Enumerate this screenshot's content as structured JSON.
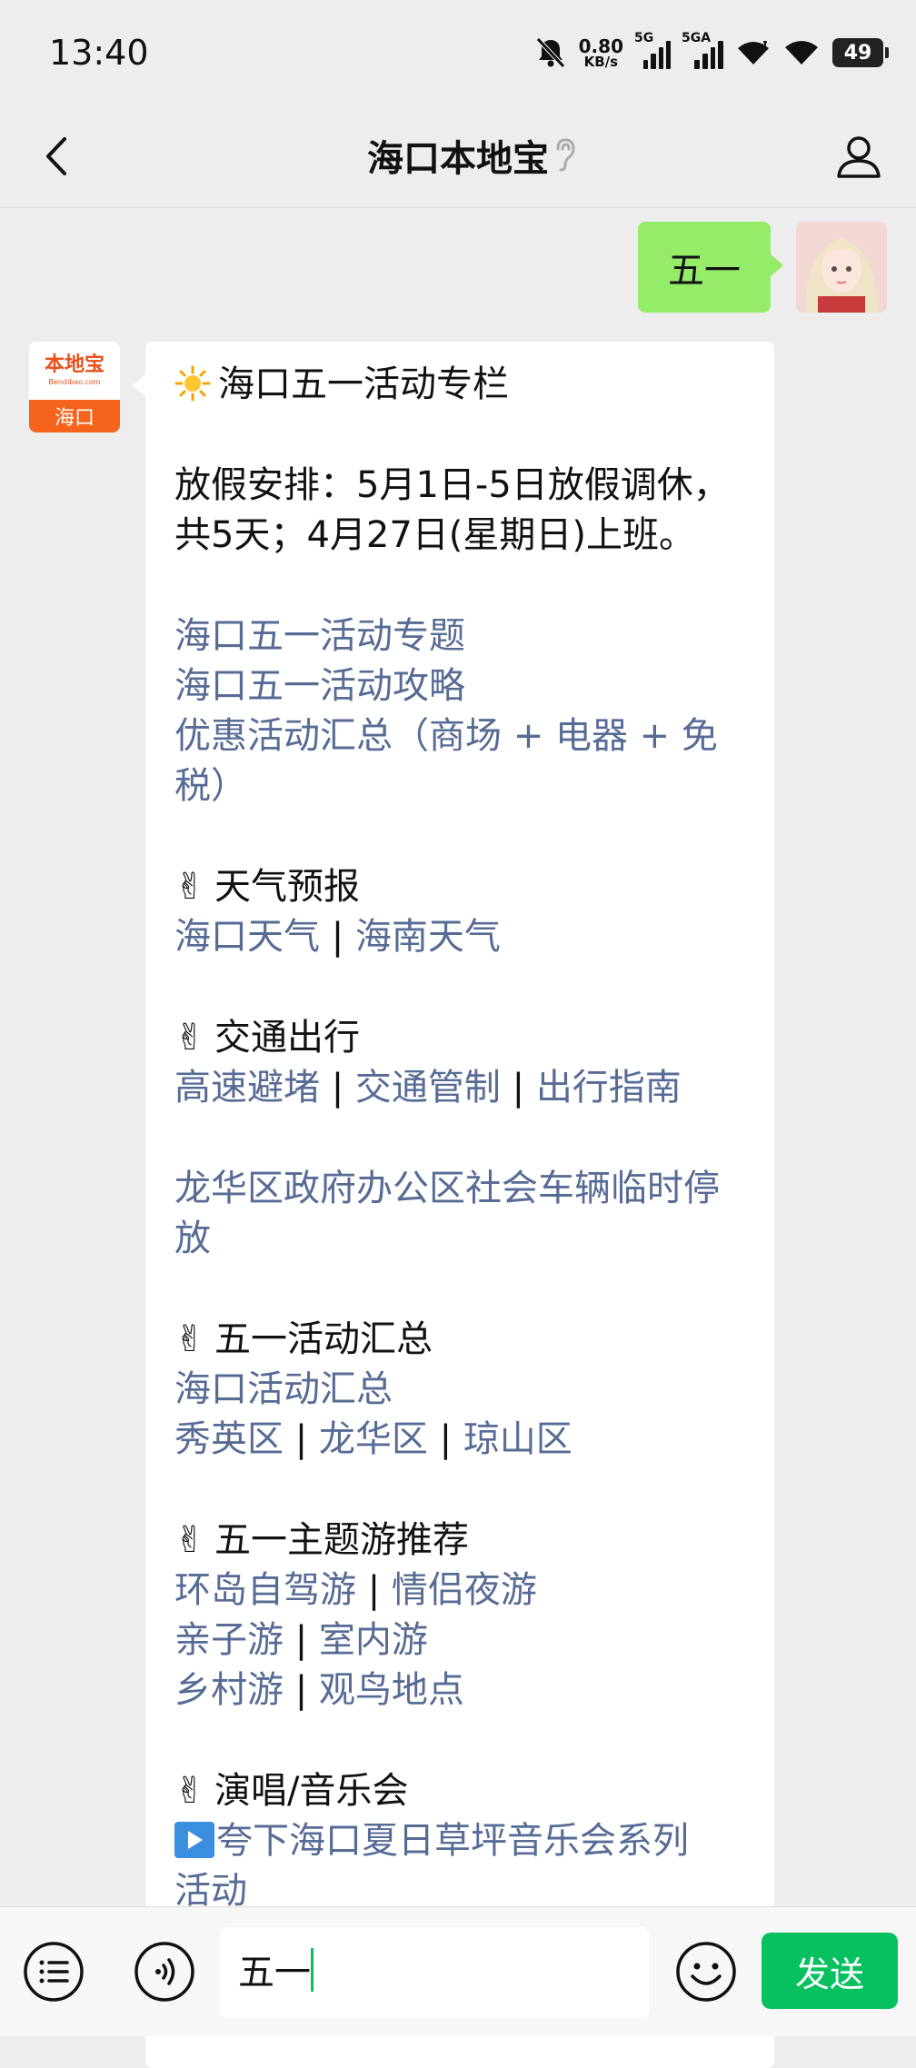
{
  "status_bar": {
    "time": "13:40",
    "net_speed_value": "0.80",
    "net_speed_unit": "KB/s",
    "signal1_label": "5G",
    "signal2_label": "5GA",
    "battery": "49"
  },
  "nav": {
    "title": "海口本地宝"
  },
  "user_message": {
    "text": "五一"
  },
  "bot": {
    "avatar_logo": "本地宝",
    "avatar_logo_sub": "Bendibao.com",
    "avatar_city": "海口",
    "header": "海口五一活动专栏",
    "holiday_line1": "放假安排：5月1日-5日放假调休，",
    "holiday_line2": "共5天；4月27日(星期日)上班。",
    "links_a": [
      "海口五一活动专题",
      "海口五一活动攻略",
      "优惠活动汇总（商场 + 电器 + 免",
      "税）"
    ],
    "weather_title": "天气预报",
    "weather_links": [
      "海口天气",
      "海南天气"
    ],
    "traffic_title": "交通出行",
    "traffic_links": [
      "高速避堵",
      "交通管制",
      "出行指南"
    ],
    "parking_line1": "龙华区政府办公区社会车辆临时停",
    "parking_line2": "放",
    "events_title": "五一活动汇总",
    "events_link": "海口活动汇总",
    "district_links": [
      "秀英区",
      "龙华区",
      "琼山区"
    ],
    "tour_title": "五一主题游推荐",
    "tour_row1": [
      "环岛自驾游",
      "情侣夜游"
    ],
    "tour_row2": [
      "亲子游",
      "室内游"
    ],
    "tour_row3": [
      "乡村游",
      "观鸟地点"
    ],
    "concert_title": "演唱/音乐会",
    "concert_line1": "夸下海口夏日草坪音乐会系列",
    "concert_line2": "活动"
  },
  "separator": " | ",
  "input": {
    "value": "五一",
    "send_label": "发送"
  }
}
